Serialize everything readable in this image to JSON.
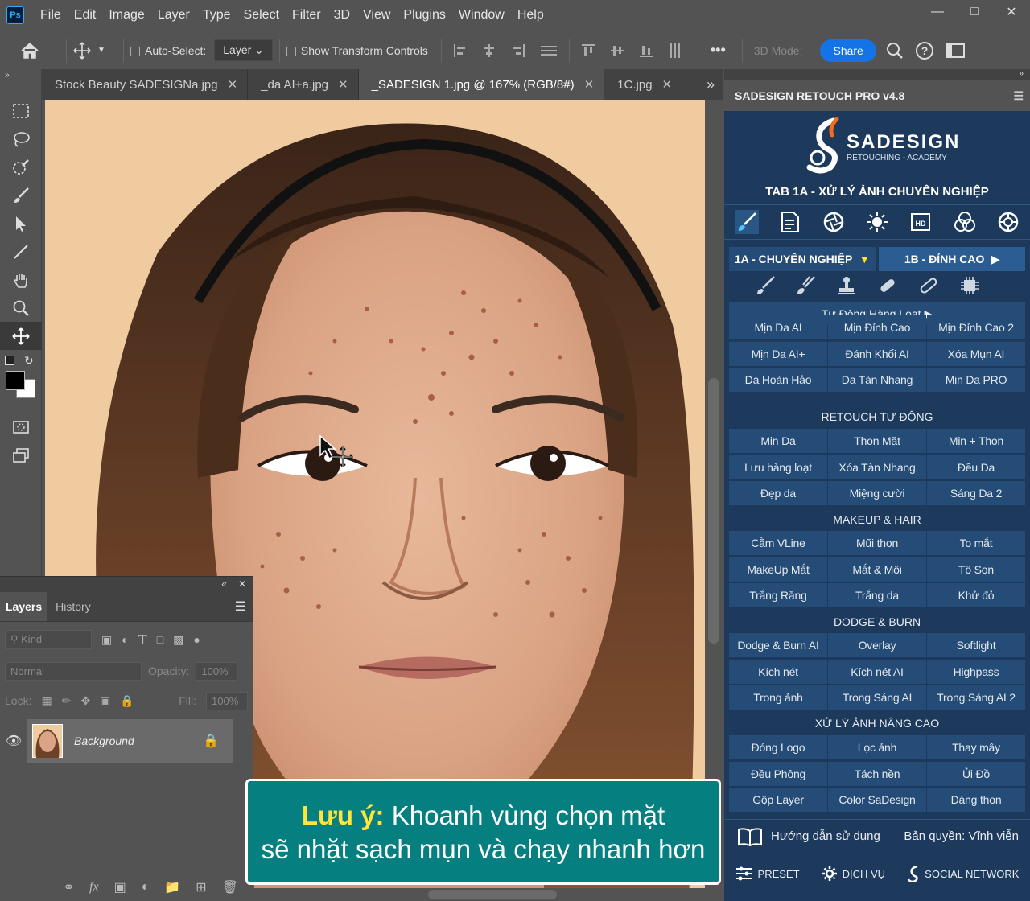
{
  "menubar": {
    "app_icon": "Ps",
    "items": [
      "File",
      "Edit",
      "Image",
      "Layer",
      "Type",
      "Select",
      "Filter",
      "3D",
      "View",
      "Plugins",
      "Window",
      "Help"
    ]
  },
  "options_bar": {
    "auto_select_label": "Auto-Select:",
    "auto_select_value": "Layer",
    "show_transform_label": "Show Transform Controls",
    "three_d_mode_label": "3D Mode:",
    "share_label": "Share",
    "more": "•••"
  },
  "tabs": [
    {
      "label": "Stock Beauty SADESIGNa.jpg"
    },
    {
      "label": "_da AI+a.jpg"
    },
    {
      "label": "_SADESIGN 1.jpg @ 167% (RGB/8#)"
    },
    {
      "label": "1C.jpg"
    }
  ],
  "layers_panel": {
    "tab_layers": "Layers",
    "tab_history": "History",
    "filter_kind": "Kind",
    "blend_mode": "Normal",
    "opacity_label": "Opacity:",
    "opacity_value": "100%",
    "lock_label": "Lock:",
    "fill_label": "Fill:",
    "fill_value": "100%",
    "layer_name": "Background"
  },
  "retouch_panel": {
    "header": "SADESIGN RETOUCH PRO v4.8",
    "brand": "SADESIGN",
    "brand_sub": "RETOUCHING - ACADEMY",
    "tab_title": "TAB 1A - XỬ LÝ ẢNH CHUYÊN NGHIỆP",
    "sub_tab_1": "1A - CHUYÊN NGHIỆP",
    "sub_tab_2": "1B - ĐỈNH CAO",
    "auto_batch": "Tự Động Hàng Loạt",
    "grid1": [
      "Mịn Da AI",
      "Mịn Đỉnh Cao",
      "Mịn Đỉnh Cao 2",
      "Mịn Da AI+",
      "Đánh Khối AI",
      "Xóa Mụn AI",
      "Da Hoàn Hảo",
      "Da Tàn Nhang",
      "Mịn Da PRO"
    ],
    "section_auto": "RETOUCH TỰ ĐỘNG",
    "grid2": [
      "Mịn Da",
      "Thon Mặt",
      "Mịn + Thon",
      "Lưu hàng loạt",
      "Xóa Tàn Nhang",
      "Đều Da",
      "Đẹp da",
      "Miệng cười",
      "Sáng Da 2"
    ],
    "section_makeup": "MAKEUP & HAIR",
    "grid3": [
      "Cằm VLine",
      "Mũi thon",
      "To mắt",
      "MakeUp Mắt",
      "Mắt & Môi",
      "Tô Son",
      "Trắng Răng",
      "Trắng da",
      "Khử đỏ"
    ],
    "section_dodge": "DODGE & BURN",
    "grid4": [
      "Dodge & Burn AI",
      "Overlay",
      "Softlight",
      "Kích nét",
      "Kích nét AI",
      "Highpass",
      "Trong ảnh",
      "Trong Sáng AI",
      "Trong Sáng AI 2"
    ],
    "section_advanced": "XỬ LÝ ẢNH NÂNG CAO",
    "grid5": [
      "Đóng Logo",
      "Lọc ảnh",
      "Thay mây",
      "Đều Phông",
      "Tách nền",
      "Ủi Đồ",
      "Gộp Layer",
      "Color SaDesign",
      "Dáng thon"
    ],
    "guide": "Hướng dẫn sử dụng",
    "license": "Bản quyền: Vĩnh viễn",
    "footer_preset": "PRESET",
    "footer_service": "DỊCH VỤ",
    "footer_social": "SOCIAL NETWORK"
  },
  "caption": {
    "highlight": "Lưu ý:",
    "line1_rest": " Khoanh vùng chọn mặt",
    "line2": "sẽ nhặt sạch mụn và chạy nhanh hơn"
  },
  "colors": {
    "panel_bg": "#1d3a5c",
    "button_bg": "#244c77",
    "caption_bg": "#067f80",
    "caption_highlight": "#ffe53b",
    "share_blue": "#1473e6"
  }
}
